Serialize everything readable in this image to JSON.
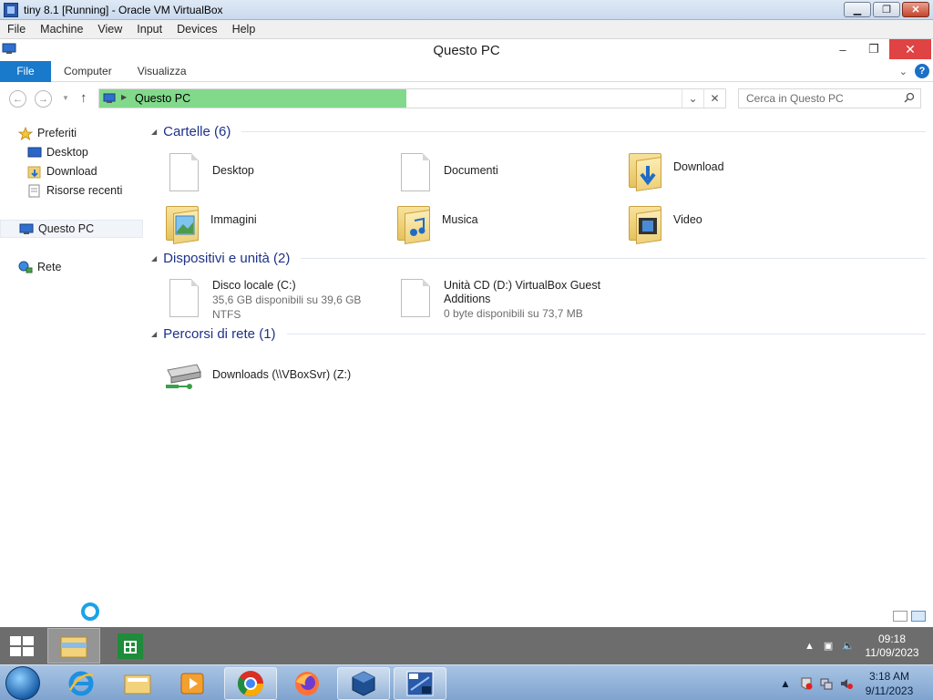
{
  "host_window": {
    "title": "tiny 8.1 [Running] - Oracle VM VirtualBox",
    "buttons": {
      "minimize": "▁",
      "restore": "❐",
      "close": "✕"
    }
  },
  "host_menu": [
    "File",
    "Machine",
    "View",
    "Input",
    "Devices",
    "Help"
  ],
  "explorer": {
    "title": "Questo PC",
    "caption": {
      "minimize": "–",
      "restore": "❐",
      "close": "✕"
    },
    "ribbon_tabs": {
      "file": "File",
      "tabs": [
        "Computer",
        "Visualizza"
      ]
    },
    "address": {
      "crumb": "Questo PC",
      "progress_fraction": 0.49
    },
    "search": {
      "placeholder": "Cerca in Questo PC"
    }
  },
  "sidebar": {
    "favorites": "Preferiti",
    "favorite_items": [
      "Desktop",
      "Download",
      "Risorse recenti"
    ],
    "this_pc": "Questo PC",
    "network": "Rete"
  },
  "groups": {
    "folders": {
      "label": "Cartelle (6)",
      "items": [
        "Desktop",
        "Documenti",
        "Download",
        "Immagini",
        "Musica",
        "Video"
      ]
    },
    "devices": {
      "label": "Dispositivi e unità (2)",
      "items": [
        {
          "name": "Disco locale (C:)",
          "lines": [
            "35,6 GB disponibili su 39,6 GB",
            "NTFS"
          ]
        },
        {
          "name": "Unità CD (D:) VirtualBox Guest",
          "name2": "Additions",
          "lines": [
            "0 byte disponibili su 73,7 MB"
          ]
        }
      ]
    },
    "network": {
      "label": "Percorsi di rete (1)",
      "items": [
        "Downloads (\\\\VBoxSvr) (Z:)"
      ]
    }
  },
  "guest_clock": {
    "time": "09:18",
    "date": "11/09/2023"
  },
  "host_clock": {
    "time": "3:18 AM",
    "date": "9/11/2023"
  },
  "colors": {
    "accent": "#1979ca",
    "address_fill": "#82d98b",
    "group_header": "#1e3287"
  }
}
